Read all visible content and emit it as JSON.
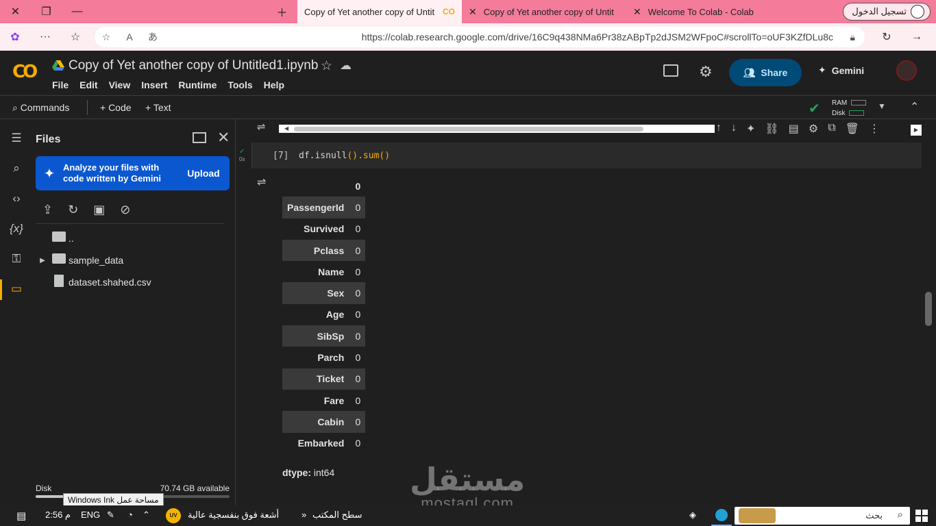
{
  "browser": {
    "tabs": [
      {
        "title": "Copy of Yet another copy of Untit",
        "active": true
      },
      {
        "title": "Copy of Yet another copy of Untit",
        "active": false
      },
      {
        "title": "Welcome To Colab - Colab",
        "active": false
      }
    ],
    "signin_label": "تسجيل الدخول",
    "url": "https://colab.research.google.com/drive/16C9q438NMa6Pr38zABpTp2dJSM2WFpoC#scrollTo=oUF3KZfDLu8c"
  },
  "colab": {
    "logo": "CO",
    "title": "Copy of Yet another copy of Untitled1.ipynb",
    "menu": [
      "File",
      "Edit",
      "View",
      "Insert",
      "Runtime",
      "Tools",
      "Help"
    ],
    "share_label": "Share",
    "gemini_label": "Gemini",
    "toolbar": {
      "commands": "Commands",
      "code": "+ Code",
      "text": "+ Text",
      "ram": "RAM",
      "disk": "Disk"
    },
    "accent": "#f9ab00"
  },
  "files_panel": {
    "title": "Files",
    "gemini_promo": "Analyze your files with code written by Gemini",
    "upload_label": "Upload",
    "tree": [
      {
        "name": "..",
        "type": "folder-open"
      },
      {
        "name": "sample_data",
        "type": "folder"
      },
      {
        "name": "dataset.shahed.csv",
        "type": "file"
      }
    ],
    "disk_label": "Disk",
    "disk_available": "70.74 GB available",
    "disk_used_fraction": 0.25,
    "ink_tooltip": "Windows Ink مساحة عمل"
  },
  "cell": {
    "exec_count": "[7]",
    "code_prefix": "df.isnull",
    "code_mid": "().sum",
    "code_suffix": "()",
    "run_status": "0s",
    "output": {
      "column_header": "0",
      "rows": [
        {
          "label": "PassengerId",
          "value": "0"
        },
        {
          "label": "Survived",
          "value": "0"
        },
        {
          "label": "Pclass",
          "value": "0"
        },
        {
          "label": "Name",
          "value": "0"
        },
        {
          "label": "Sex",
          "value": "0"
        },
        {
          "label": "Age",
          "value": "0"
        },
        {
          "label": "SibSp",
          "value": "0"
        },
        {
          "label": "Parch",
          "value": "0"
        },
        {
          "label": "Ticket",
          "value": "0"
        },
        {
          "label": "Fare",
          "value": "0"
        },
        {
          "label": "Cabin",
          "value": "0"
        },
        {
          "label": "Embarked",
          "value": "0"
        }
      ],
      "dtype_label": "dtype:",
      "dtype_value": "int64"
    }
  },
  "watermark": {
    "arabic": "مستقل",
    "latin": "mostaql.com"
  },
  "taskbar": {
    "time": "2:56 م",
    "lang": "ENG",
    "weather": "أشعة فوق بنفسجية عالية",
    "uv_badge": "UV",
    "desktop": "سطح المكتب",
    "search": "بحث"
  }
}
